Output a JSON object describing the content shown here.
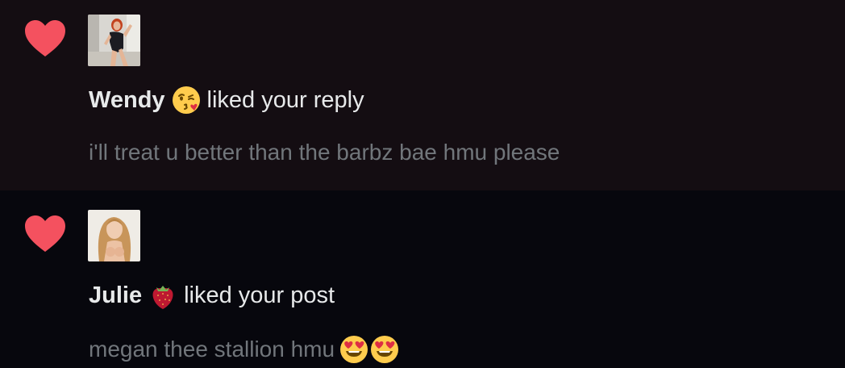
{
  "notifications": [
    {
      "icon": "heart-icon",
      "avatar_alt": "Wendy avatar",
      "name": "Wendy",
      "name_emoji": "kissing-face-emoji",
      "action": "liked your reply",
      "snippet": "i'll treat u better than the barbz bae hmu please"
    },
    {
      "icon": "heart-icon",
      "avatar_alt": "Julie avatar",
      "name": "Julie",
      "name_emoji": "strawberry-emoji",
      "action": "liked your post",
      "snippet": "megan thee stallion hmu",
      "snippet_emojis": [
        "heart-eyes-emoji",
        "heart-eyes-emoji"
      ]
    }
  ],
  "colors": {
    "heart": "#f4515f",
    "primary_text": "#e7e9ea",
    "secondary_text": "#71767b",
    "row1_bg": "#140d12",
    "row2_bg": "#07070d"
  }
}
